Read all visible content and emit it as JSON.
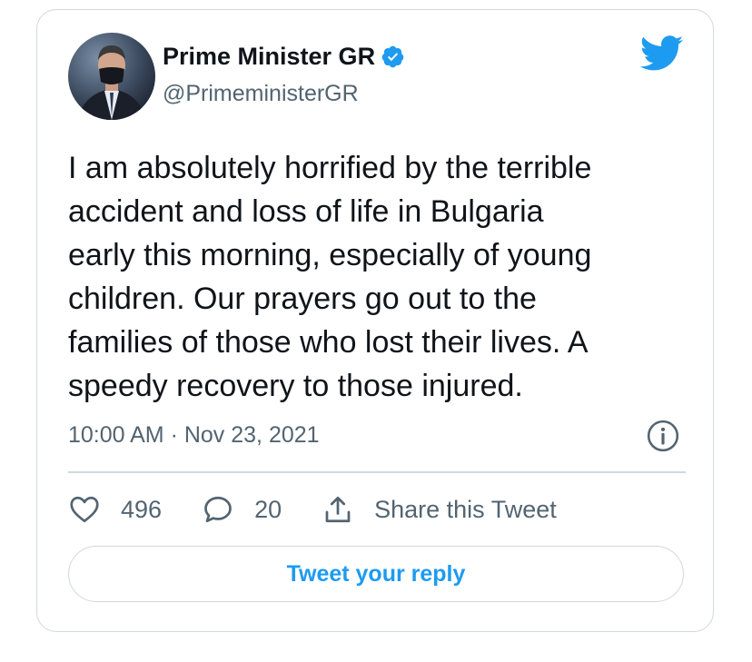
{
  "author": {
    "name": "Prime Minister GR",
    "handle": "@PrimeministerGR",
    "verified": true
  },
  "tweet": {
    "text": "I am absolutely horrified by the terrible\naccident and loss of life in Bulgaria\nearly this morning, especially of young\nchildren. Our prayers go out to the\nfamilies of those who lost their lives. A\nspeedy recovery to those injured.",
    "timestamp": "10:00 AM · Nov 23, 2021"
  },
  "actions": {
    "likes": "496",
    "replies": "20",
    "share_label": "Share this Tweet"
  },
  "reply_button": {
    "label": "Tweet your reply"
  },
  "colors": {
    "accent": "#1d9bf0",
    "muted": "#536471",
    "border": "#cfd9de"
  },
  "icons": [
    "twitter-bird-icon",
    "verified-badge-icon",
    "info-icon",
    "heart-icon",
    "reply-bubble-icon",
    "share-icon"
  ]
}
